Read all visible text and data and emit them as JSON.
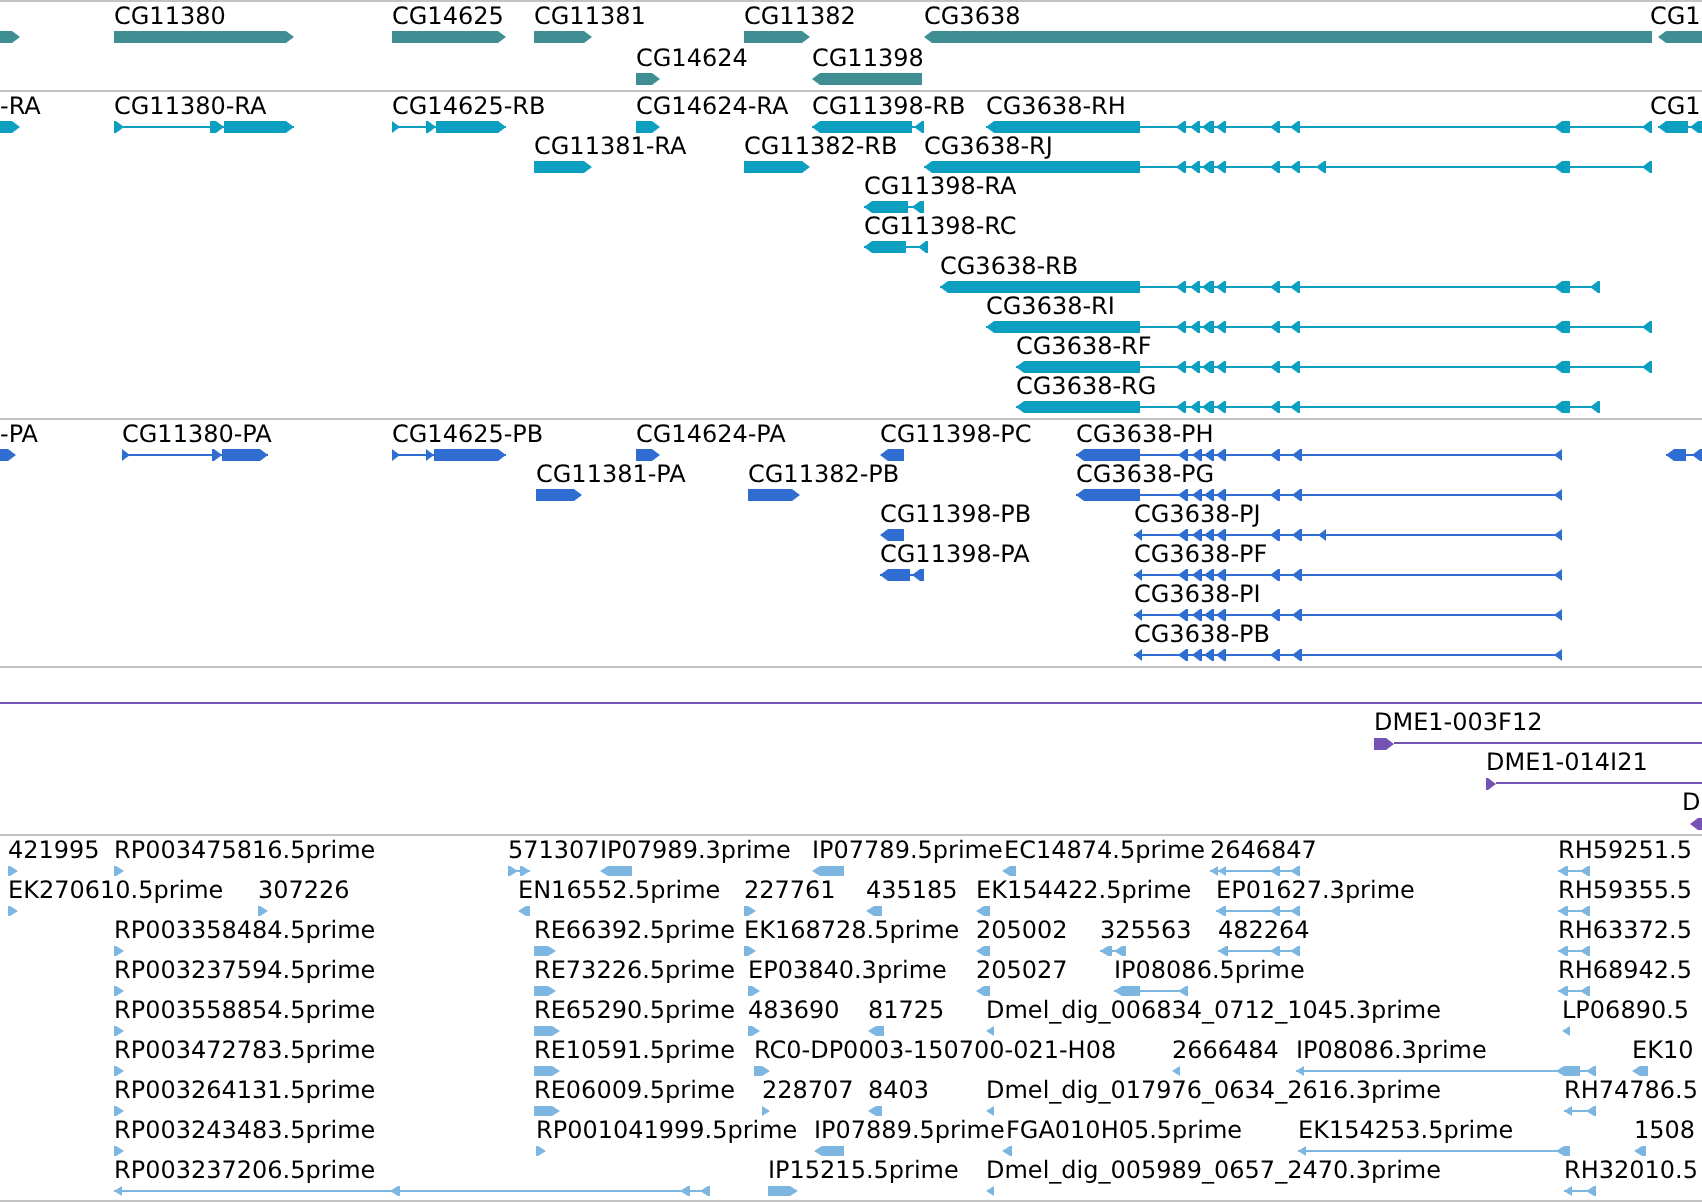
{
  "tracks": [
    {
      "kind": "gene",
      "lanes": [
        {
          "features": [
            {
              "reverse": false
            },
            {
              "label": "CG11380",
              "reverse": false
            },
            {
              "label": "CG14625",
              "reverse": false
            },
            {
              "label": "CG11381",
              "reverse": false
            },
            {
              "label": "CG11382",
              "reverse": false
            },
            {
              "label": "CG3638",
              "reverse": true
            },
            {
              "label": "CG1",
              "reverse": true
            }
          ]
        },
        {
          "features": [
            {
              "label": "CG14624",
              "reverse": false
            },
            {
              "label": "CG11398",
              "reverse": true
            }
          ]
        }
      ]
    },
    {
      "kind": "transcript",
      "lanes": [
        {
          "features": [
            {
              "label": "-RA",
              "reverse": false
            },
            {
              "label": "CG11380-RA",
              "reverse": false
            },
            {
              "label": "CG14625-RB",
              "reverse": false
            },
            {
              "label": "CG14624-RA",
              "reverse": false
            },
            {
              "label": "CG11398-RB",
              "reverse": true
            },
            {
              "label": "CG3638-RH",
              "reverse": true
            },
            {
              "label": "CG1",
              "reverse": true
            }
          ]
        },
        {
          "features": [
            {
              "label": "CG11381-RA",
              "reverse": false
            },
            {
              "label": "CG11382-RB",
              "reverse": false
            },
            {
              "label": "CG3638-RJ",
              "reverse": true
            }
          ]
        },
        {
          "features": [
            {
              "label": "CG11398-RA",
              "reverse": true
            }
          ]
        },
        {
          "features": [
            {
              "label": "CG11398-RC",
              "reverse": true
            }
          ]
        },
        {
          "features": [
            {
              "label": "CG3638-RB",
              "reverse": true
            }
          ]
        },
        {
          "features": [
            {
              "label": "CG3638-RI",
              "reverse": true
            }
          ]
        },
        {
          "features": [
            {
              "label": "CG3638-RF",
              "reverse": true
            }
          ]
        },
        {
          "features": [
            {
              "label": "CG3638-RG",
              "reverse": true
            }
          ]
        }
      ]
    },
    {
      "kind": "protein",
      "lanes": [
        {
          "features": [
            {
              "label": "-PA",
              "reverse": false
            },
            {
              "label": "CG11380-PA",
              "reverse": false
            },
            {
              "label": "CG14625-PB",
              "reverse": false
            },
            {
              "label": "CG14624-PA",
              "reverse": false
            },
            {
              "label": "CG11398-PC",
              "reverse": true
            },
            {
              "label": "CG3638-PH",
              "reverse": true
            },
            {
              "reverse": true
            }
          ]
        },
        {
          "features": [
            {
              "label": "CG11381-PA",
              "reverse": false
            },
            {
              "label": "CG11382-PB",
              "reverse": false
            },
            {
              "label": "CG3638-PG",
              "reverse": true
            }
          ]
        },
        {
          "features": [
            {
              "label": "CG11398-PB",
              "reverse": true
            },
            {
              "label": "CG3638-PJ",
              "reverse": true
            }
          ]
        },
        {
          "features": [
            {
              "label": "CG11398-PA",
              "reverse": true
            },
            {
              "label": "CG3638-PF",
              "reverse": true
            }
          ]
        },
        {
          "features": [
            {
              "label": "CG3638-PI",
              "reverse": true
            }
          ]
        },
        {
          "features": [
            {
              "label": "CG3638-PB",
              "reverse": true
            }
          ]
        }
      ]
    },
    {
      "kind": "clone",
      "lanes": [
        {
          "features": [
            {
              "kind": "span"
            }
          ]
        },
        {
          "features": [
            {
              "kind": "clone",
              "label": "DME1-003F12",
              "reverse": false
            }
          ]
        },
        {
          "features": [
            {
              "kind": "clone",
              "label": "DME1-014I21",
              "reverse": false
            }
          ]
        },
        {
          "features": [
            {
              "kind": "clone",
              "label": "D",
              "reverse": true
            }
          ]
        }
      ]
    },
    {
      "kind": "est",
      "lanes": [
        {
          "features": [
            {
              "label": "421995",
              "reverse": false
            },
            {
              "label": "RP003475816.5prime",
              "reverse": false
            },
            {
              "label": "571307",
              "reverse": false
            },
            {
              "label": "IP07989.3prime",
              "reverse": true
            },
            {
              "label": "IP07789.5prime",
              "reverse": true
            },
            {
              "label": "EC14874.5prime",
              "reverse": true
            },
            {
              "label": "2646847",
              "reverse": true
            },
            {
              "label": "RH59251.5",
              "reverse": true
            }
          ]
        },
        {
          "features": [
            {
              "label": "EK270610.5prime",
              "reverse": false
            },
            {
              "label": "307226",
              "reverse": false
            },
            {
              "label": "EN16552.5prime",
              "reverse": true
            },
            {
              "label": "227761",
              "reverse": false
            },
            {
              "label": "435185",
              "reverse": true
            },
            {
              "label": "EK154422.5prime",
              "reverse": true
            },
            {
              "label": "EP01627.3prime",
              "reverse": true
            },
            {
              "label": "RH59355.5",
              "reverse": true
            }
          ]
        },
        {
          "features": [
            {
              "label": "RP003358484.5prime",
              "reverse": false
            },
            {
              "label": "RE66392.5prime",
              "reverse": false
            },
            {
              "label": "EK168728.5prime",
              "reverse": false
            },
            {
              "label": "205002",
              "reverse": true
            },
            {
              "label": "325563",
              "reverse": true
            },
            {
              "label": "482264",
              "reverse": true
            },
            {
              "label": "RH63372.5",
              "reverse": true
            }
          ]
        },
        {
          "features": [
            {
              "label": "RP003237594.5prime",
              "reverse": false
            },
            {
              "label": "RE73226.5prime",
              "reverse": false
            },
            {
              "label": "EP03840.3prime",
              "reverse": false
            },
            {
              "label": "205027",
              "reverse": true
            },
            {
              "label": "IP08086.5prime",
              "reverse": true
            },
            {
              "label": "RH68942.5",
              "reverse": true
            }
          ]
        },
        {
          "features": [
            {
              "label": "RP003558854.5prime",
              "reverse": false
            },
            {
              "label": "RE65290.5prime",
              "reverse": false
            },
            {
              "label": "483690",
              "reverse": false
            },
            {
              "label": "81725",
              "reverse": true
            },
            {
              "label": "Dmel_dig_006834_0712_1045.3prime",
              "reverse": true
            },
            {
              "label": "LP06890.5",
              "reverse": true
            }
          ]
        },
        {
          "features": [
            {
              "label": "RP003472783.5prime",
              "reverse": false
            },
            {
              "label": "RE10591.5prime",
              "reverse": false
            },
            {
              "label": "RC0-DP0003-150700-021-H08",
              "reverse": false
            },
            {
              "label": "2666484",
              "reverse": true
            },
            {
              "label": "IP08086.3prime",
              "reverse": true
            },
            {
              "label": "EK10",
              "reverse": true
            }
          ]
        },
        {
          "features": [
            {
              "label": "RP003264131.5prime",
              "reverse": false
            },
            {
              "label": "RE06009.5prime",
              "reverse": false
            },
            {
              "label": "228707",
              "reverse": false
            },
            {
              "label": "8403",
              "reverse": true
            },
            {
              "label": "Dmel_dig_017976_0634_2616.3prime",
              "reverse": true
            },
            {
              "label": "RH74786.5",
              "reverse": true
            }
          ]
        },
        {
          "features": [
            {
              "label": "RP003243483.5prime",
              "reverse": false
            },
            {
              "label": "RP001041999.5prime",
              "reverse": false
            },
            {
              "label": "IP07889.5prime",
              "reverse": true
            },
            {
              "label": "FGA010H05.5prime",
              "reverse": true
            },
            {
              "label": "EK154253.5prime",
              "reverse": true
            },
            {
              "label": "1508",
              "reverse": true
            }
          ]
        },
        {
          "features": [
            {
              "label": "RP003237206.5prime",
              "reverse": true
            },
            {
              "label": "IP15215.5prime",
              "reverse": false
            },
            {
              "label": "Dmel_dig_005989_0657_2470.3prime",
              "reverse": true
            },
            {
              "label": "RH32010.5",
              "reverse": true
            }
          ]
        }
      ]
    }
  ]
}
